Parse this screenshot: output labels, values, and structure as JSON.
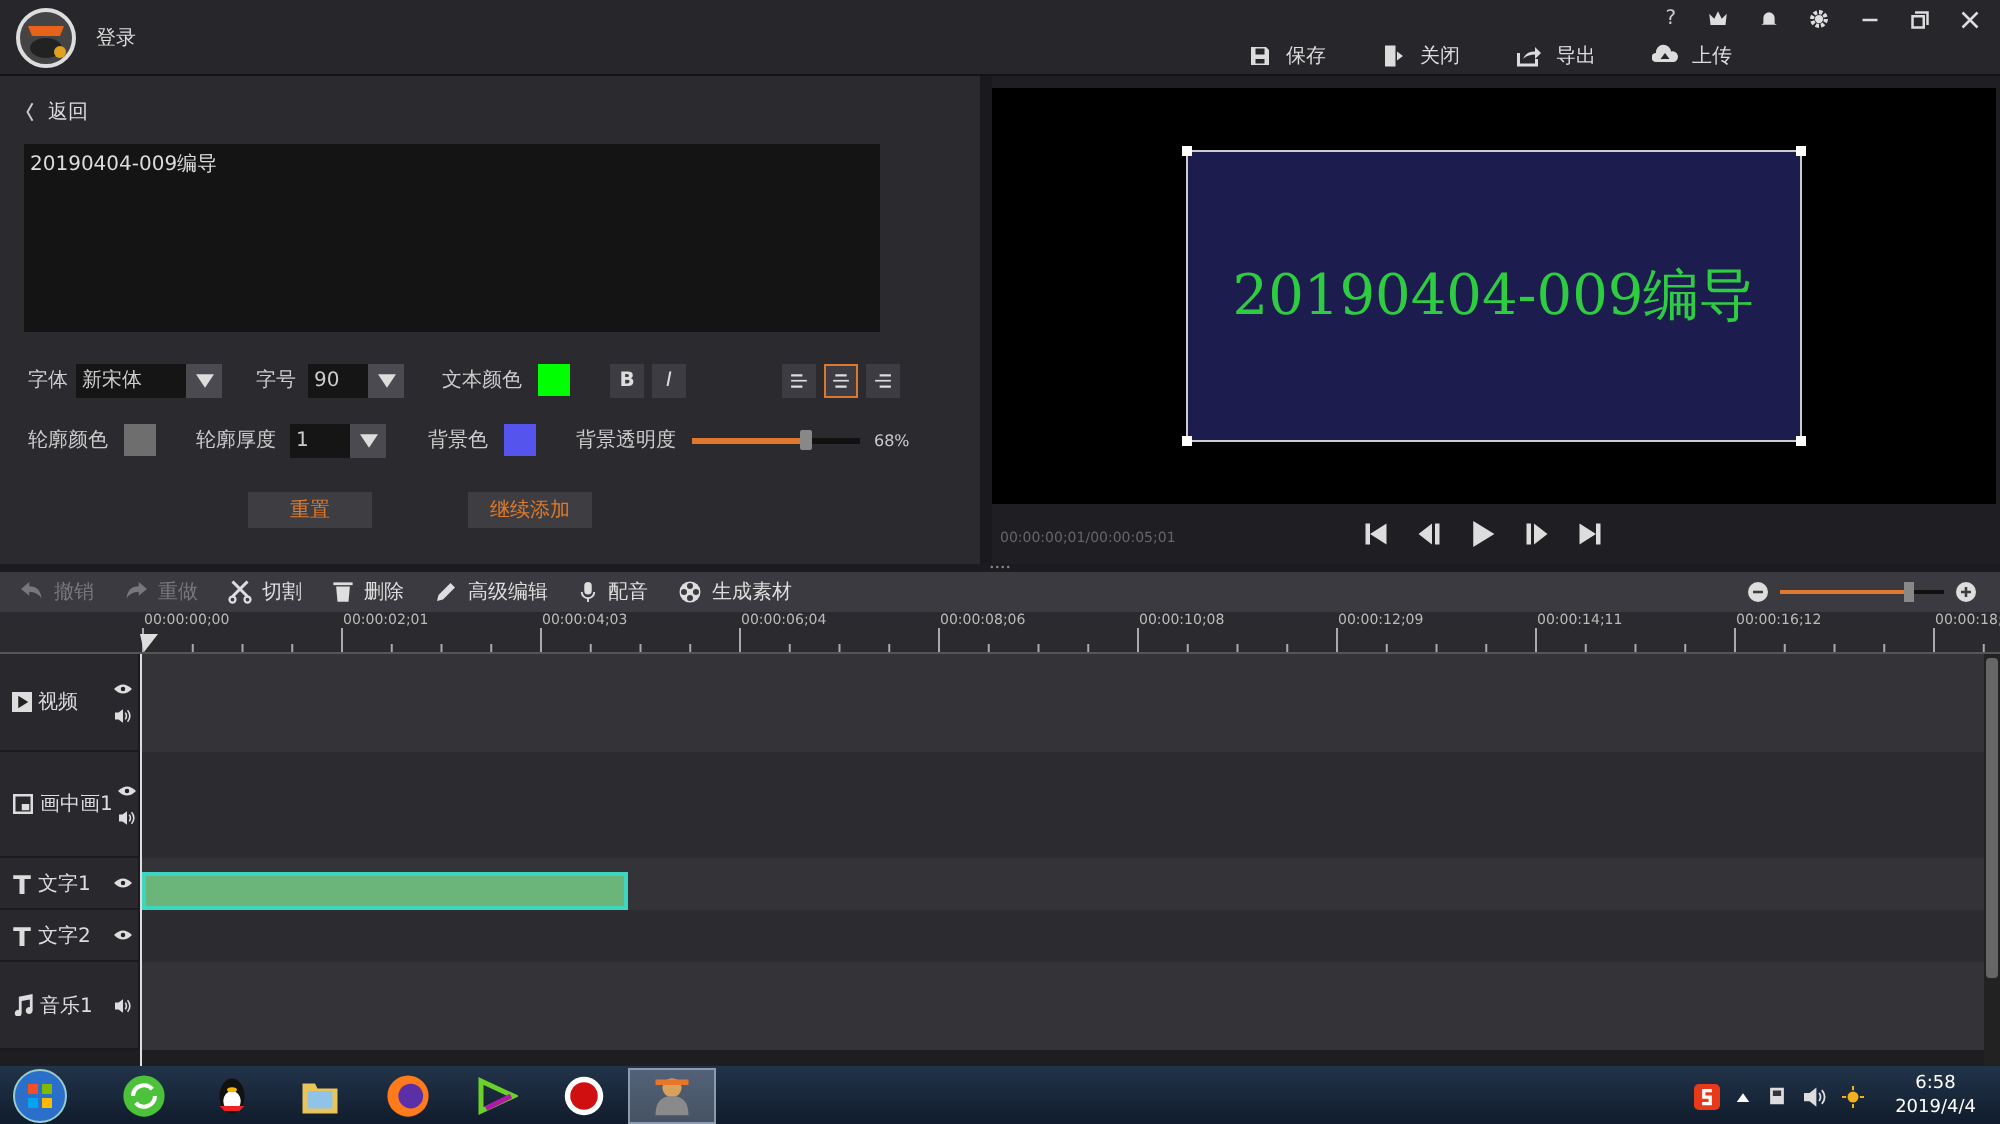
{
  "header": {
    "login": "登录",
    "help": "?",
    "actions": [
      {
        "kind": "save",
        "label": "保存"
      },
      {
        "kind": "close",
        "label": "关闭"
      },
      {
        "kind": "export",
        "label": "导出"
      },
      {
        "kind": "upload",
        "label": "上传"
      }
    ]
  },
  "editor": {
    "back": "返回",
    "text": "20190404-009编导",
    "font": {
      "label": "字体",
      "value": "新宋体"
    },
    "size": {
      "label": "字号",
      "value": "90"
    },
    "text_color": {
      "label": "文本颜色",
      "color": "#00ff00"
    },
    "bold": "B",
    "italic": "I",
    "align": [
      {
        "kind": "left",
        "selected": false
      },
      {
        "kind": "center",
        "selected": true
      },
      {
        "kind": "right",
        "selected": false
      }
    ],
    "outline_color": {
      "label": "轮廓颜色",
      "color": "#6e6e6e"
    },
    "outline_width": {
      "label": "轮廓厚度",
      "value": "1"
    },
    "bg_color": {
      "label": "背景色",
      "color": "#5555ee"
    },
    "opacity": {
      "label": "背景透明度",
      "level": 0.68,
      "reading": "68%"
    },
    "buttons": [
      "重置",
      "继续添加"
    ]
  },
  "preview": {
    "text": "20190404-009编导",
    "time": "00:00:00;01/00:00:05;01"
  },
  "toolbar": [
    {
      "kind": "undo",
      "label": "撤销",
      "disabled": true
    },
    {
      "kind": "redo",
      "label": "重做",
      "disabled": true
    },
    {
      "kind": "cut",
      "label": "切割",
      "disabled": false
    },
    {
      "kind": "delete",
      "label": "删除",
      "disabled": false
    },
    {
      "kind": "edit",
      "label": "高级编辑",
      "disabled": false
    },
    {
      "kind": "dub",
      "label": "配音",
      "disabled": false
    },
    {
      "kind": "generate",
      "label": "生成素材",
      "disabled": false
    }
  ],
  "zoom": {
    "level": 0.78
  },
  "ruler": [
    "00:00:00;00",
    "00:00:02;01",
    "00:00:04;03",
    "00:00:06;04",
    "00:00:08;06",
    "00:00:10;08",
    "00:00:12;09",
    "00:00:14;11",
    "00:00:16;12",
    "00:00:18;"
  ],
  "tracks": [
    {
      "kind": "video",
      "name": "视频",
      "eye": true,
      "sound": true,
      "clip": false
    },
    {
      "kind": "pip",
      "name": "画中画1",
      "eye": true,
      "sound": true,
      "clip": false
    },
    {
      "kind": "text",
      "name": "文字1",
      "eye": true,
      "sound": false,
      "clip": true
    },
    {
      "kind": "text",
      "name": "文字2",
      "eye": true,
      "sound": false,
      "clip": false
    },
    {
      "kind": "music",
      "name": "音乐1",
      "eye": false,
      "sound": true,
      "clip": false
    }
  ],
  "taskbar": {
    "apps": [
      {
        "kind": "refresh",
        "selected": false
      },
      {
        "kind": "penguin",
        "selected": false
      },
      {
        "kind": "folder",
        "selected": false
      },
      {
        "kind": "browser",
        "selected": false
      },
      {
        "kind": "player",
        "selected": false
      },
      {
        "kind": "record",
        "selected": false
      },
      {
        "kind": "editor",
        "selected": true
      }
    ],
    "time": "6:58",
    "date": "2019/4/4"
  }
}
